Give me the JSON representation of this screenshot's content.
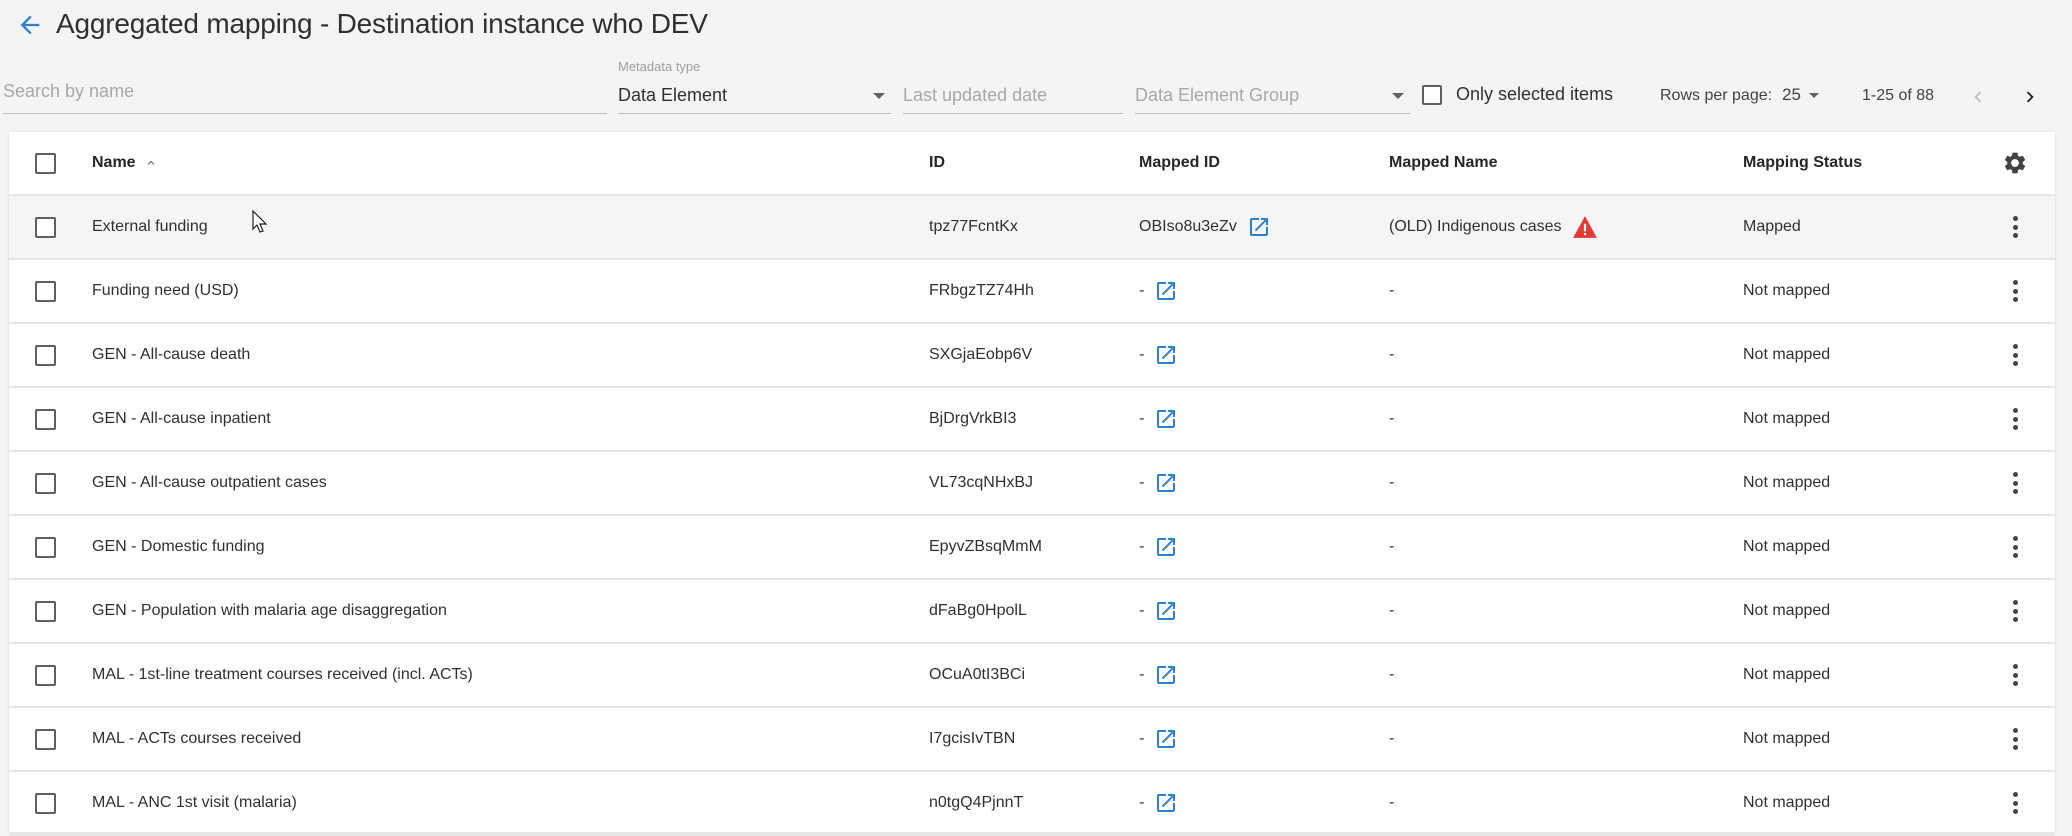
{
  "header": {
    "back_icon": "arrow-left-icon",
    "title": "Aggregated mapping - Destination instance who DEV"
  },
  "filters": {
    "search": {
      "placeholder": "Search by name",
      "value": ""
    },
    "metadata_type": {
      "label": "Metadata type",
      "value": "Data Element"
    },
    "last_updated": {
      "placeholder": "Last updated date"
    },
    "group": {
      "placeholder": "Data Element Group"
    },
    "only_selected": {
      "label": "Only selected items",
      "checked": false
    }
  },
  "pagination": {
    "rows_per_page_label": "Rows per page:",
    "rows_per_page": "25",
    "range": "1-25 of 88"
  },
  "colors": {
    "accent": "#2f7fcf",
    "warning": "#e53935",
    "background": "#f4f4f6"
  },
  "table": {
    "columns": {
      "name": "Name",
      "id": "ID",
      "mapped_id": "Mapped ID",
      "mapped_name": "Mapped Name",
      "status": "Mapping Status"
    },
    "sort": {
      "column": "Name",
      "direction": "asc"
    },
    "rows": [
      {
        "name": "External funding",
        "id": "tpz77FcntKx",
        "mapped_id": "OBIso8u3eZv",
        "mapped_name": "(OLD) Indigenous cases",
        "warning": true,
        "status": "Mapped"
      },
      {
        "name": "Funding need (USD)",
        "id": "FRbgzTZ74Hh",
        "mapped_id": "-",
        "mapped_name": "-",
        "warning": false,
        "status": "Not mapped"
      },
      {
        "name": "GEN - All-cause death",
        "id": "SXGjaEobp6V",
        "mapped_id": "-",
        "mapped_name": "-",
        "warning": false,
        "status": "Not mapped"
      },
      {
        "name": "GEN - All-cause inpatient",
        "id": "BjDrgVrkBI3",
        "mapped_id": "-",
        "mapped_name": "-",
        "warning": false,
        "status": "Not mapped"
      },
      {
        "name": "GEN - All-cause outpatient cases",
        "id": "VL73cqNHxBJ",
        "mapped_id": "-",
        "mapped_name": "-",
        "warning": false,
        "status": "Not mapped"
      },
      {
        "name": "GEN - Domestic funding",
        "id": "EpyvZBsqMmM",
        "mapped_id": "-",
        "mapped_name": "-",
        "warning": false,
        "status": "Not mapped"
      },
      {
        "name": "GEN - Population with malaria age disaggregation",
        "id": "dFaBg0HpolL",
        "mapped_id": "-",
        "mapped_name": "-",
        "warning": false,
        "status": "Not mapped"
      },
      {
        "name": "MAL - 1st-line treatment courses received (incl. ACTs)",
        "id": "OCuA0tI3BCi",
        "mapped_id": "-",
        "mapped_name": "-",
        "warning": false,
        "status": "Not mapped"
      },
      {
        "name": "MAL - ACTs courses received",
        "id": "I7gcisIvTBN",
        "mapped_id": "-",
        "mapped_name": "-",
        "warning": false,
        "status": "Not mapped"
      },
      {
        "name": "MAL - ANC 1st visit (malaria)",
        "id": "n0tgQ4PjnnT",
        "mapped_id": "-",
        "mapped_name": "-",
        "warning": false,
        "status": "Not mapped"
      }
    ]
  }
}
